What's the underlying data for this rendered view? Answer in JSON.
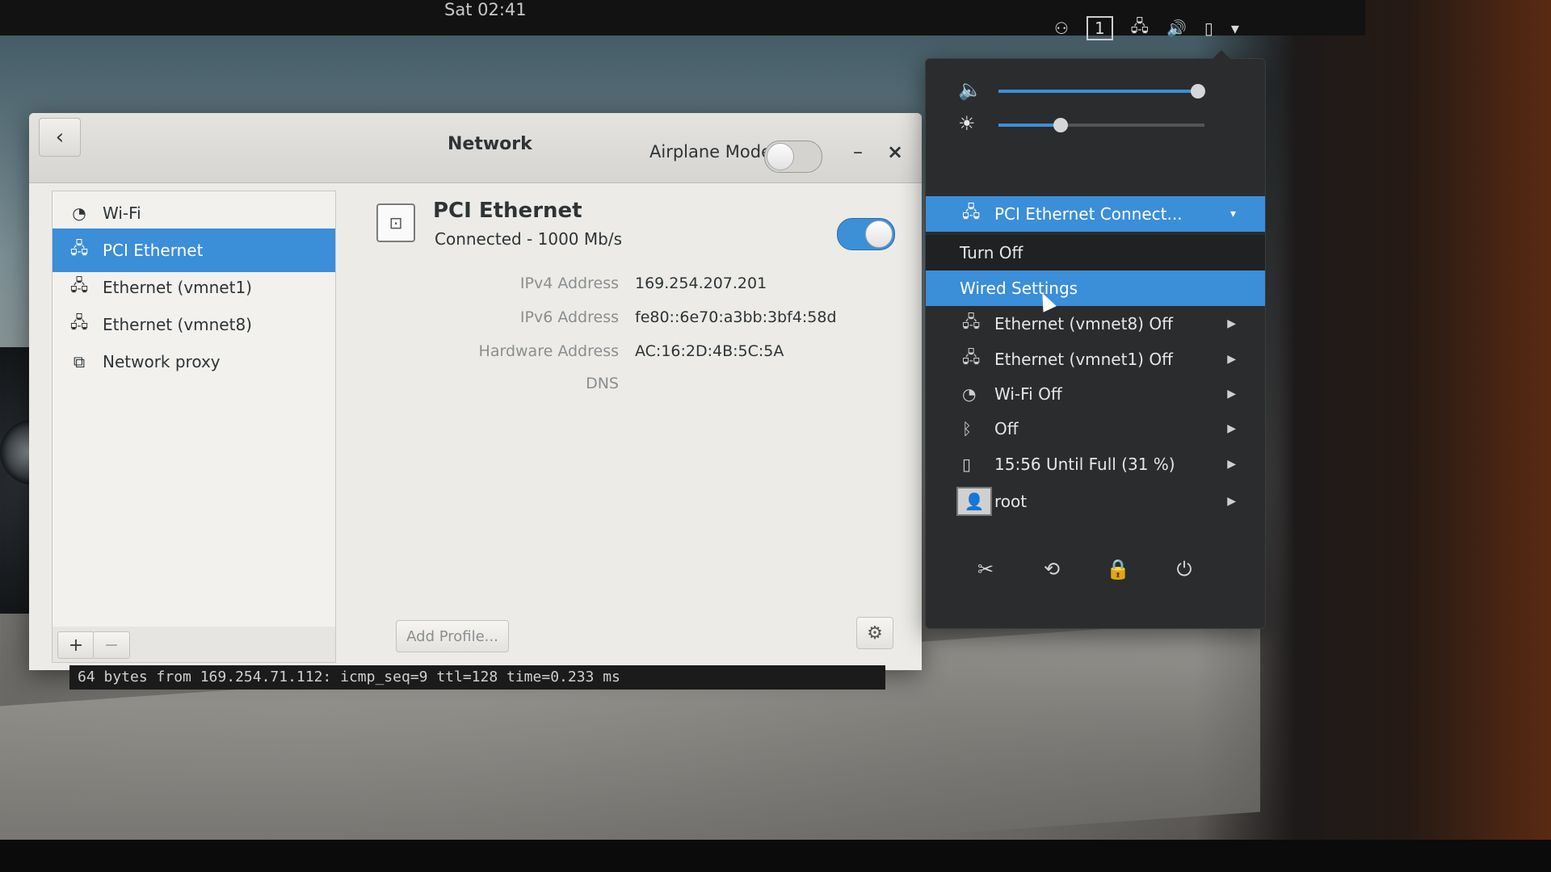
{
  "topbar": {
    "clock": "Sat 02:41",
    "workspace": "1",
    "icons": [
      "accessibility-icon",
      "network-icon",
      "volume-icon",
      "battery-icon",
      "chevron-down-icon"
    ]
  },
  "window": {
    "title": "Network",
    "airplane_label": "Airplane Mode",
    "airplane_mode": false,
    "minimize": "–",
    "close": "×",
    "back": "‹"
  },
  "sidebar": {
    "items": [
      {
        "label": "Wi-Fi",
        "icon": "wifi-icon",
        "selected": false
      },
      {
        "label": "PCI Ethernet",
        "icon": "wired-network-icon",
        "selected": true
      },
      {
        "label": "Ethernet (vmnet1)",
        "icon": "wired-network-disconnected-icon",
        "selected": false
      },
      {
        "label": "Ethernet (vmnet8)",
        "icon": "wired-network-disconnected-icon",
        "selected": false
      },
      {
        "label": "Network proxy",
        "icon": "network-proxy-icon",
        "selected": false
      }
    ],
    "add_label": "+",
    "remove_label": "−"
  },
  "detail": {
    "title": "PCI Ethernet",
    "status": "Connected - 1000 Mb/s",
    "enabled": true,
    "rows": [
      {
        "key": "IPv4 Address",
        "value": "169.254.207.201"
      },
      {
        "key": "IPv6 Address",
        "value": "fe80::6e70:a3bb:3bf4:58d"
      },
      {
        "key": "Hardware Address",
        "value": "AC:16:2D:4B:5C:5A"
      },
      {
        "key": "DNS",
        "value": ""
      }
    ],
    "add_profile": "Add Profile..."
  },
  "terminal": {
    "line": "64 bytes from 169.254.71.112: icmp_seq=9 ttl=128 time=0.233 ms"
  },
  "sysmenu": {
    "volume_level": 0.97,
    "brightness_level": 0.3,
    "connection_header": "PCI Ethernet Connect...",
    "turn_off": "Turn Off",
    "wired_settings": "Wired Settings",
    "items": [
      {
        "label": "Ethernet (vmnet8) Off",
        "icon": "wired-network-disconnected-icon"
      },
      {
        "label": "Ethernet (vmnet1) Off",
        "icon": "wired-network-disconnected-icon"
      },
      {
        "label": "Wi-Fi Off",
        "icon": "wifi-icon"
      },
      {
        "label": "Off",
        "icon": "bluetooth-icon"
      },
      {
        "label": "15:56 Until Full (31 %)",
        "icon": "battery-icon"
      },
      {
        "label": "root",
        "icon": "user-avatar-icon"
      }
    ],
    "actions": [
      "settings-icon",
      "rotation-lock-icon",
      "lock-icon",
      "power-icon"
    ]
  }
}
